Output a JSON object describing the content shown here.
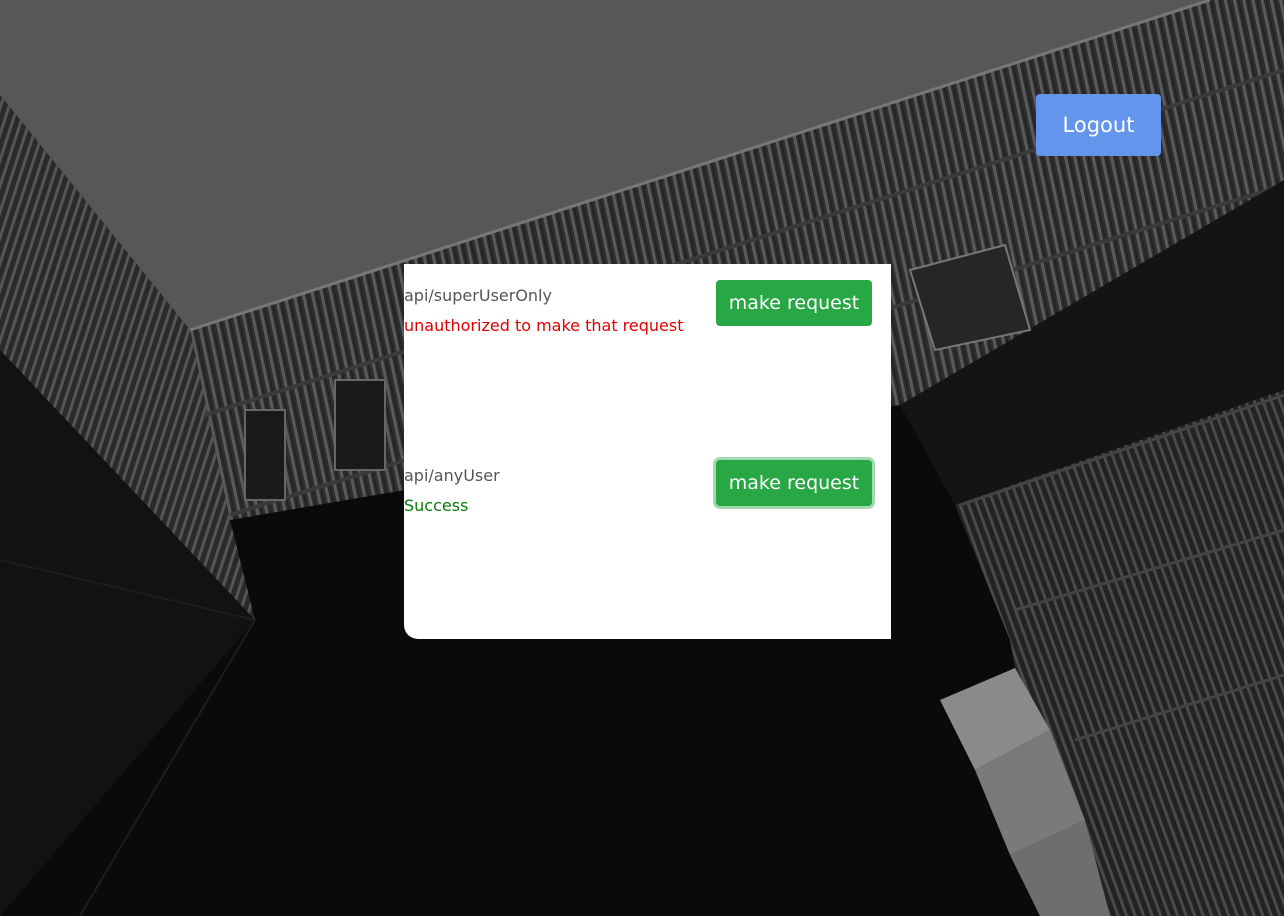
{
  "header": {
    "logout_label": "Logout"
  },
  "endpoints": [
    {
      "path": "api/superUserOnly",
      "button_label": "make request",
      "status": "unauthorized to make that request",
      "status_color": "#e00000"
    },
    {
      "path": "api/anyUser",
      "button_label": "make request",
      "status": "Success",
      "status_color": "#0a7a0a"
    }
  ],
  "colors": {
    "logout_button": "#6495ed",
    "request_button": "#28a745",
    "panel": "#ffffff"
  }
}
